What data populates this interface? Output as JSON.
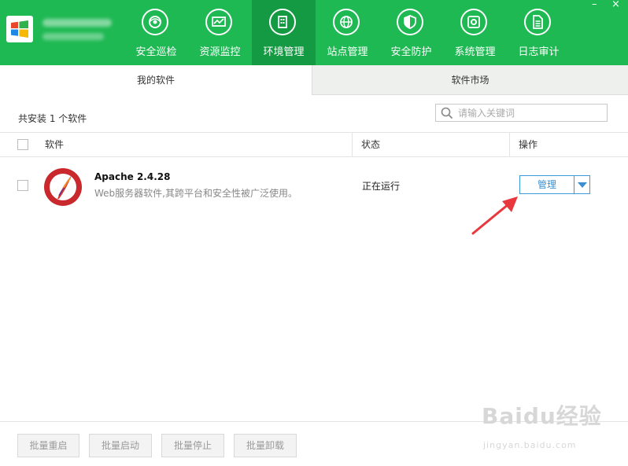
{
  "header": {
    "nav": [
      {
        "label": "安全巡检",
        "icon": "shield-eye-icon"
      },
      {
        "label": "资源监控",
        "icon": "monitor-icon"
      },
      {
        "label": "环境管理",
        "icon": "building-icon",
        "active": true
      },
      {
        "label": "站点管理",
        "icon": "globe-icon"
      },
      {
        "label": "安全防护",
        "icon": "shield-icon"
      },
      {
        "label": "系统管理",
        "icon": "gear-icon"
      },
      {
        "label": "日志审计",
        "icon": "document-icon"
      }
    ],
    "minimize": "–",
    "close": "×"
  },
  "tabs": {
    "my_software": "我的软件",
    "market": "软件市场"
  },
  "summary": "共安装 1 个软件",
  "search": {
    "placeholder": "请输入关键词"
  },
  "table": {
    "headers": {
      "software": "软件",
      "status": "状态",
      "action": "操作"
    },
    "rows": [
      {
        "name": "Apache 2.4.28",
        "description": "Web服务器软件,其跨平台和安全性被广泛使用。",
        "status": "正在运行",
        "action": "管理"
      }
    ]
  },
  "footer": {
    "buttons": [
      "批量重启",
      "批量启动",
      "批量停止",
      "批量卸载"
    ]
  },
  "watermark": {
    "brand": "Baidu经验",
    "url": "jingyan.baidu.com"
  },
  "colors": {
    "header": "#1fb954",
    "active_nav": "#139a43",
    "accent": "#3b8fd0",
    "arrow": "#e8383d"
  }
}
